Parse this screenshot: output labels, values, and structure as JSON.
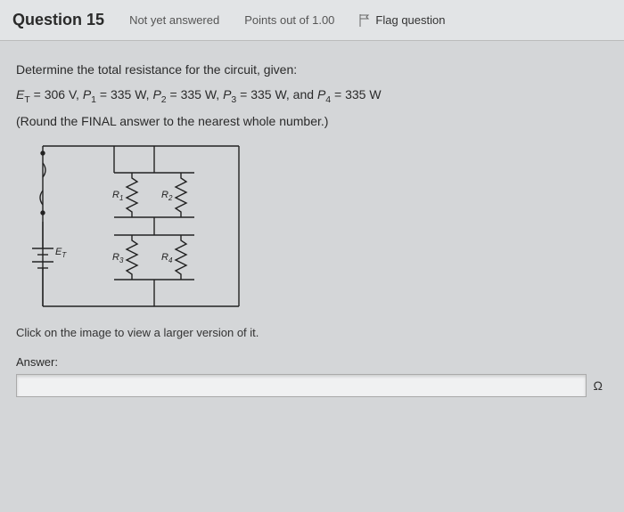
{
  "header": {
    "question_label": "Question",
    "question_number": "15",
    "status": "Not yet answered",
    "points": "Points out of 1.00",
    "flag": "Flag question"
  },
  "body": {
    "prompt": "Determine the total resistance for the circuit, given:",
    "givens_html": "E_T = 306 V, P_1 = 335 W, P_2 = 335 W, P_3 = 335 W, and P_4 = 335 W",
    "ET_label": "E",
    "ET_sub": "T",
    "ET_val": "= 306 V,",
    "P1_label": "P",
    "P1_sub": "1",
    "P1_val": "= 335 W,",
    "P2_label": "P",
    "P2_sub": "2",
    "P2_val": "= 335 W,",
    "P3_label": "P",
    "P3_sub": "3",
    "P3_val": "= 335 W, and",
    "P4_label": "P",
    "P4_sub": "4",
    "P4_val": "= 335 W",
    "round_note": "(Round the FINAL answer to the nearest whole number.)",
    "circuit_labels": {
      "ET": "E_T",
      "R1": "R₁",
      "R2": "R₂",
      "R3": "R₃",
      "R4": "R₄"
    },
    "image_note": "Click on the image to view a larger version of it.",
    "answer_label": "Answer:",
    "answer_value": "",
    "unit": "Ω"
  }
}
